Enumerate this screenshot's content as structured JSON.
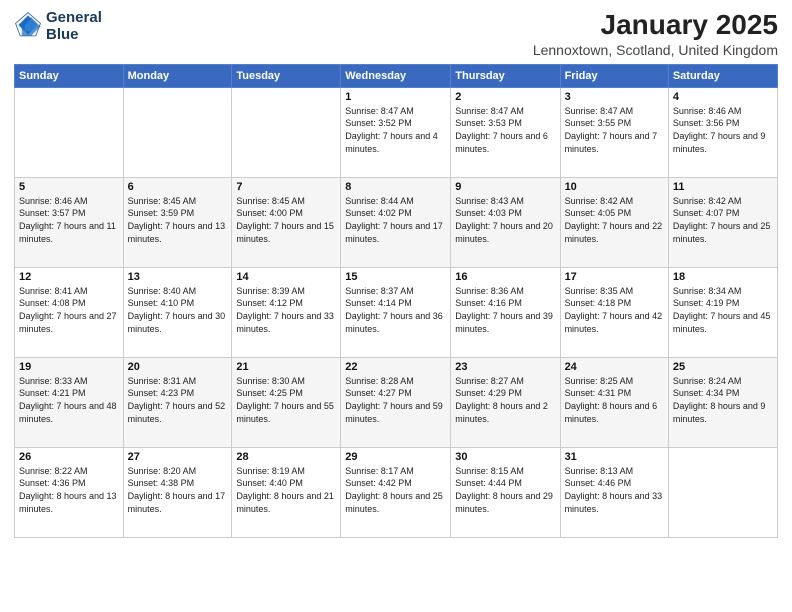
{
  "logo": {
    "line1": "General",
    "line2": "Blue"
  },
  "title": "January 2025",
  "location": "Lennoxtown, Scotland, United Kingdom",
  "weekdays": [
    "Sunday",
    "Monday",
    "Tuesday",
    "Wednesday",
    "Thursday",
    "Friday",
    "Saturday"
  ],
  "weeks": [
    [
      {
        "day": "",
        "sunrise": "",
        "sunset": "",
        "daylight": ""
      },
      {
        "day": "",
        "sunrise": "",
        "sunset": "",
        "daylight": ""
      },
      {
        "day": "",
        "sunrise": "",
        "sunset": "",
        "daylight": ""
      },
      {
        "day": "1",
        "sunrise": "Sunrise: 8:47 AM",
        "sunset": "Sunset: 3:52 PM",
        "daylight": "Daylight: 7 hours and 4 minutes."
      },
      {
        "day": "2",
        "sunrise": "Sunrise: 8:47 AM",
        "sunset": "Sunset: 3:53 PM",
        "daylight": "Daylight: 7 hours and 6 minutes."
      },
      {
        "day": "3",
        "sunrise": "Sunrise: 8:47 AM",
        "sunset": "Sunset: 3:55 PM",
        "daylight": "Daylight: 7 hours and 7 minutes."
      },
      {
        "day": "4",
        "sunrise": "Sunrise: 8:46 AM",
        "sunset": "Sunset: 3:56 PM",
        "daylight": "Daylight: 7 hours and 9 minutes."
      }
    ],
    [
      {
        "day": "5",
        "sunrise": "Sunrise: 8:46 AM",
        "sunset": "Sunset: 3:57 PM",
        "daylight": "Daylight: 7 hours and 11 minutes."
      },
      {
        "day": "6",
        "sunrise": "Sunrise: 8:45 AM",
        "sunset": "Sunset: 3:59 PM",
        "daylight": "Daylight: 7 hours and 13 minutes."
      },
      {
        "day": "7",
        "sunrise": "Sunrise: 8:45 AM",
        "sunset": "Sunset: 4:00 PM",
        "daylight": "Daylight: 7 hours and 15 minutes."
      },
      {
        "day": "8",
        "sunrise": "Sunrise: 8:44 AM",
        "sunset": "Sunset: 4:02 PM",
        "daylight": "Daylight: 7 hours and 17 minutes."
      },
      {
        "day": "9",
        "sunrise": "Sunrise: 8:43 AM",
        "sunset": "Sunset: 4:03 PM",
        "daylight": "Daylight: 7 hours and 20 minutes."
      },
      {
        "day": "10",
        "sunrise": "Sunrise: 8:42 AM",
        "sunset": "Sunset: 4:05 PM",
        "daylight": "Daylight: 7 hours and 22 minutes."
      },
      {
        "day": "11",
        "sunrise": "Sunrise: 8:42 AM",
        "sunset": "Sunset: 4:07 PM",
        "daylight": "Daylight: 7 hours and 25 minutes."
      }
    ],
    [
      {
        "day": "12",
        "sunrise": "Sunrise: 8:41 AM",
        "sunset": "Sunset: 4:08 PM",
        "daylight": "Daylight: 7 hours and 27 minutes."
      },
      {
        "day": "13",
        "sunrise": "Sunrise: 8:40 AM",
        "sunset": "Sunset: 4:10 PM",
        "daylight": "Daylight: 7 hours and 30 minutes."
      },
      {
        "day": "14",
        "sunrise": "Sunrise: 8:39 AM",
        "sunset": "Sunset: 4:12 PM",
        "daylight": "Daylight: 7 hours and 33 minutes."
      },
      {
        "day": "15",
        "sunrise": "Sunrise: 8:37 AM",
        "sunset": "Sunset: 4:14 PM",
        "daylight": "Daylight: 7 hours and 36 minutes."
      },
      {
        "day": "16",
        "sunrise": "Sunrise: 8:36 AM",
        "sunset": "Sunset: 4:16 PM",
        "daylight": "Daylight: 7 hours and 39 minutes."
      },
      {
        "day": "17",
        "sunrise": "Sunrise: 8:35 AM",
        "sunset": "Sunset: 4:18 PM",
        "daylight": "Daylight: 7 hours and 42 minutes."
      },
      {
        "day": "18",
        "sunrise": "Sunrise: 8:34 AM",
        "sunset": "Sunset: 4:19 PM",
        "daylight": "Daylight: 7 hours and 45 minutes."
      }
    ],
    [
      {
        "day": "19",
        "sunrise": "Sunrise: 8:33 AM",
        "sunset": "Sunset: 4:21 PM",
        "daylight": "Daylight: 7 hours and 48 minutes."
      },
      {
        "day": "20",
        "sunrise": "Sunrise: 8:31 AM",
        "sunset": "Sunset: 4:23 PM",
        "daylight": "Daylight: 7 hours and 52 minutes."
      },
      {
        "day": "21",
        "sunrise": "Sunrise: 8:30 AM",
        "sunset": "Sunset: 4:25 PM",
        "daylight": "Daylight: 7 hours and 55 minutes."
      },
      {
        "day": "22",
        "sunrise": "Sunrise: 8:28 AM",
        "sunset": "Sunset: 4:27 PM",
        "daylight": "Daylight: 7 hours and 59 minutes."
      },
      {
        "day": "23",
        "sunrise": "Sunrise: 8:27 AM",
        "sunset": "Sunset: 4:29 PM",
        "daylight": "Daylight: 8 hours and 2 minutes."
      },
      {
        "day": "24",
        "sunrise": "Sunrise: 8:25 AM",
        "sunset": "Sunset: 4:31 PM",
        "daylight": "Daylight: 8 hours and 6 minutes."
      },
      {
        "day": "25",
        "sunrise": "Sunrise: 8:24 AM",
        "sunset": "Sunset: 4:34 PM",
        "daylight": "Daylight: 8 hours and 9 minutes."
      }
    ],
    [
      {
        "day": "26",
        "sunrise": "Sunrise: 8:22 AM",
        "sunset": "Sunset: 4:36 PM",
        "daylight": "Daylight: 8 hours and 13 minutes."
      },
      {
        "day": "27",
        "sunrise": "Sunrise: 8:20 AM",
        "sunset": "Sunset: 4:38 PM",
        "daylight": "Daylight: 8 hours and 17 minutes."
      },
      {
        "day": "28",
        "sunrise": "Sunrise: 8:19 AM",
        "sunset": "Sunset: 4:40 PM",
        "daylight": "Daylight: 8 hours and 21 minutes."
      },
      {
        "day": "29",
        "sunrise": "Sunrise: 8:17 AM",
        "sunset": "Sunset: 4:42 PM",
        "daylight": "Daylight: 8 hours and 25 minutes."
      },
      {
        "day": "30",
        "sunrise": "Sunrise: 8:15 AM",
        "sunset": "Sunset: 4:44 PM",
        "daylight": "Daylight: 8 hours and 29 minutes."
      },
      {
        "day": "31",
        "sunrise": "Sunrise: 8:13 AM",
        "sunset": "Sunset: 4:46 PM",
        "daylight": "Daylight: 8 hours and 33 minutes."
      },
      {
        "day": "",
        "sunrise": "",
        "sunset": "",
        "daylight": ""
      }
    ]
  ]
}
